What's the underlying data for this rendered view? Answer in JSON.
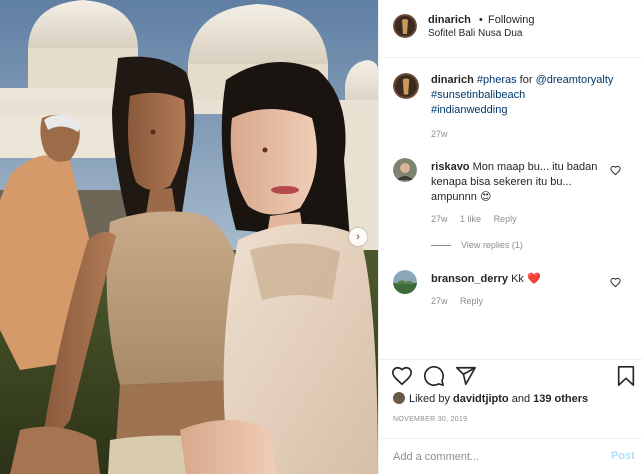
{
  "post": {
    "author": "dinarich",
    "dot": "•",
    "follow_status": "Following",
    "location": "Sofitel Bali Nusa Dua",
    "more_label": "···"
  },
  "caption": {
    "username": "dinarich",
    "text_pre": "#pheras",
    "text_mid": " for ",
    "mention": "@dreamtoryalty",
    "tag1": "#sunsetinbalibeach",
    "tag2": "#indianwedding",
    "time": "27w"
  },
  "comments": [
    {
      "username": "riskavo",
      "text": "Mon maap bu... itu badan kenapa bisa sekeren itu bu... ampunnn",
      "emoji": "😍",
      "time": "27w",
      "likes": "1 like",
      "reply": "Reply",
      "view_replies": "View replies (1)"
    },
    {
      "username": "branson_derry",
      "text": "Kk",
      "emoji": "❤️",
      "time": "27w",
      "reply": "Reply"
    }
  ],
  "likes": {
    "prefix": "Liked by",
    "user": "davidtjipto",
    "mid": "and",
    "others": "139 others"
  },
  "date": "NOVEMBER 30, 2019",
  "add_comment": {
    "placeholder": "Add a comment...",
    "post_label": "Post"
  },
  "icons": {
    "like": "heart-icon",
    "comment": "comment-icon",
    "share": "share-icon",
    "save": "bookmark-icon",
    "next": "chevron-right-icon"
  },
  "colors": {
    "link": "#00376b",
    "muted": "#8e8e8e",
    "post_disabled": "#b2dffc",
    "heart": "#ed4956"
  }
}
